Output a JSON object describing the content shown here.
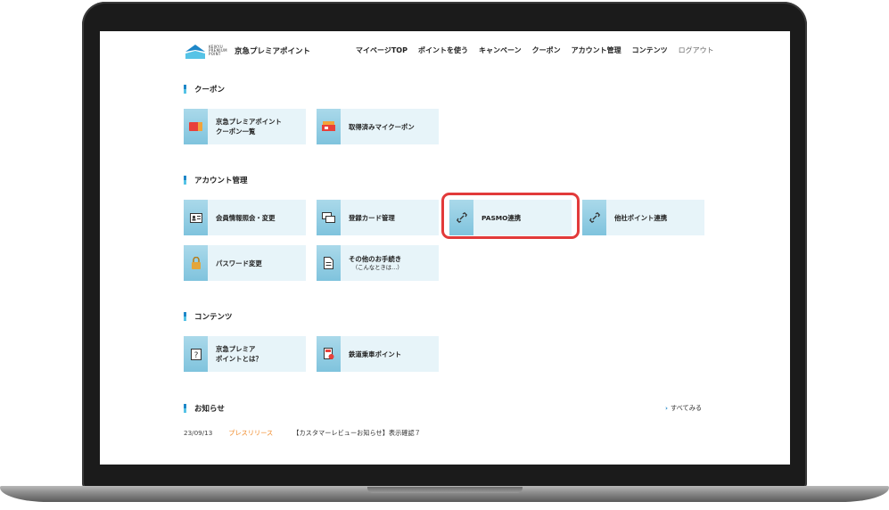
{
  "header": {
    "logo_sub": "KEIKYU PREMIUM POINT",
    "logo_name": "京急プレミアポイント",
    "nav": [
      "マイページTOP",
      "ポイントを使う",
      "キャンペーン",
      "クーポン",
      "アカウント管理",
      "コンテンツ"
    ],
    "logout": "ログアウト"
  },
  "sections": {
    "coupon": {
      "title": "クーポン",
      "tiles": [
        {
          "line1": "京急プレミアポイント",
          "line2": "クーポン一覧",
          "icon": "coupon-ticket-icon"
        },
        {
          "line1": "取得済みマイクーポン",
          "icon": "acquired-coupon-icon"
        }
      ]
    },
    "account": {
      "title": "アカウント管理",
      "tiles": [
        {
          "line1": "会員情報照会・変更",
          "icon": "member-card-icon"
        },
        {
          "line1": "登録カード管理",
          "icon": "cards-icon"
        },
        {
          "line1": "PASMO連携",
          "icon": "link-icon"
        },
        {
          "line1": "他社ポイント連携",
          "icon": "link-icon"
        },
        {
          "line1": "パスワード変更",
          "icon": "lock-icon"
        },
        {
          "line1": "その他のお手続き",
          "line2": "（こんなときは…）",
          "icon": "document-icon"
        }
      ]
    },
    "contents": {
      "title": "コンテンツ",
      "tiles": [
        {
          "line1": "京急プレミア",
          "line2": "ポイントとは？",
          "icon": "question-icon"
        },
        {
          "line1": "鉄道乗車ポイント",
          "icon": "train-ticket-icon"
        }
      ]
    },
    "news": {
      "title": "お知らせ",
      "more": "すべてみる",
      "items": [
        {
          "date": "23/09/13",
          "tag": "プレスリリース",
          "text": "【カスタマーレビューお知らせ】表示確認７"
        }
      ]
    }
  },
  "colors": {
    "accent": "#1e87c8",
    "tile_bg": "#e7f4f9",
    "highlight": "#e23a3a",
    "news_tag": "#f08a28"
  }
}
